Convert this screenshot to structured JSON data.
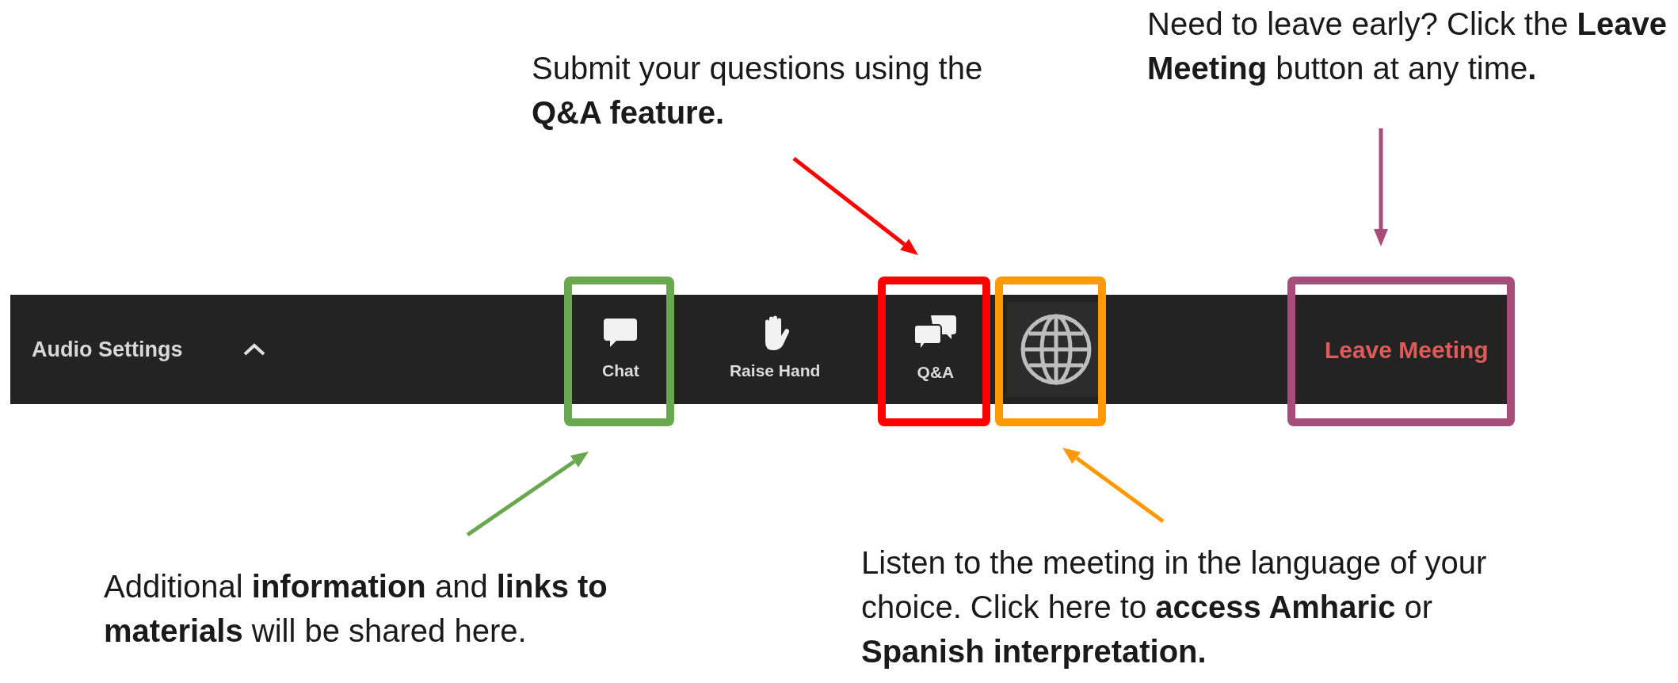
{
  "toolbar": {
    "audio_settings": "Audio Settings",
    "buttons": [
      {
        "kind": "chat",
        "label": "Chat"
      },
      {
        "kind": "hand",
        "label": "Raise Hand"
      },
      {
        "kind": "qa",
        "label": "Q&A"
      },
      {
        "kind": "globe"
      },
      {
        "kind": "leave",
        "label": "Leave Meeting"
      }
    ]
  },
  "callouts": [
    {
      "text": "Submit your questions using the **Q&A feature.**",
      "color": "#ff0000"
    },
    {
      "text": "Need to leave early? Click the **Leave Meeting** button at any time**.**",
      "color": "#a64d79"
    },
    {
      "text": "Additional **information** and **links to materials** will be shared here.",
      "color": "#6aa84f"
    },
    {
      "text": "Listen to the meeting in the language of your choice. Click here to **access Amharic** or **Spanish interpretation.**",
      "color": "#ff9900"
    }
  ]
}
